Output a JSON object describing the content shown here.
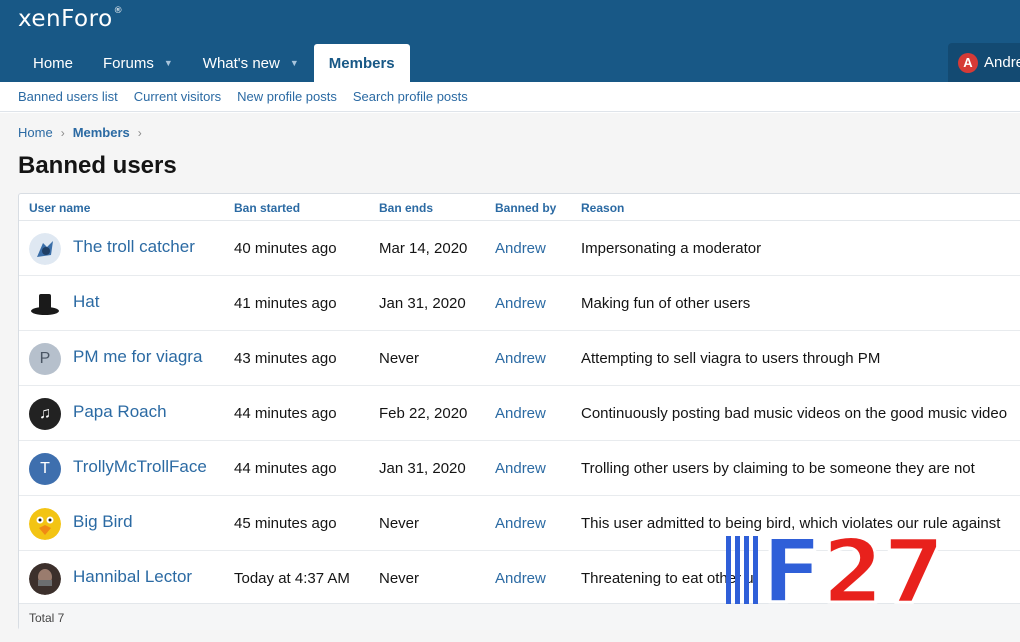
{
  "brand": {
    "logo_text": "xenForo",
    "logo_mark": "®"
  },
  "nav": {
    "tabs": [
      {
        "label": "Home",
        "caret": ""
      },
      {
        "label": "Forums",
        "caret": "▼"
      },
      {
        "label": "What's new",
        "caret": "▼"
      },
      {
        "label": "Members",
        "caret": ""
      }
    ],
    "active": "Members",
    "user_label": "Andre",
    "user_initial": "A"
  },
  "sub_nav": [
    "Banned users list",
    "Current visitors",
    "New profile posts",
    "Search profile posts"
  ],
  "breadcrumb": {
    "home": "Home",
    "current": "Members",
    "sep": "›"
  },
  "page_title": "Banned users",
  "table": {
    "headers": [
      "User name",
      "Ban started",
      "Ban ends",
      "Banned by",
      "Reason"
    ],
    "rows": [
      {
        "user": "The troll catcher",
        "avatar_letter": "",
        "avatar_color": "#b9cfe6",
        "started": "40 minutes ago",
        "ends": "Mar 14, 2020",
        "by": "Andrew",
        "reason": "Impersonating a moderator"
      },
      {
        "user": "Hat",
        "avatar_letter": "",
        "avatar_color": "#ffffff",
        "started": "41 minutes ago",
        "ends": "Jan 31, 2020",
        "by": "Andrew",
        "reason": "Making fun of other users"
      },
      {
        "user": "PM me for viagra",
        "avatar_letter": "P",
        "avatar_color": "#b6c0cc",
        "started": "43 minutes ago",
        "ends": "Never",
        "by": "Andrew",
        "reason": "Attempting to sell viagra to users through PM"
      },
      {
        "user": "Papa Roach",
        "avatar_letter": "♫",
        "avatar_color": "#222222",
        "started": "44 minutes ago",
        "ends": "Feb 22, 2020",
        "by": "Andrew",
        "reason": "Continuously posting bad music videos on the good music video"
      },
      {
        "user": "TrollyMcTrollFace",
        "avatar_letter": "T",
        "avatar_color": "#3e6fae",
        "started": "44 minutes ago",
        "ends": "Jan 31, 2020",
        "by": "Andrew",
        "reason": "Trolling other users by claiming to be someone they are not"
      },
      {
        "user": "Big Bird",
        "avatar_letter": "",
        "avatar_color": "#f3c414",
        "started": "45 minutes ago",
        "ends": "Never",
        "by": "Andrew",
        "reason": "This user admitted to being bird, which violates our rule against"
      },
      {
        "user": "Hannibal Lector",
        "avatar_letter": "",
        "avatar_color": "#5a4a44",
        "started": "Today at 4:37 AM",
        "ends": "Never",
        "by": "Andrew",
        "reason": "Threatening to eat other u"
      }
    ],
    "total": "Total 7"
  },
  "watermark": {
    "text": "F27",
    "color_main": "#e8211c",
    "color_f": "#2f5fd8"
  }
}
